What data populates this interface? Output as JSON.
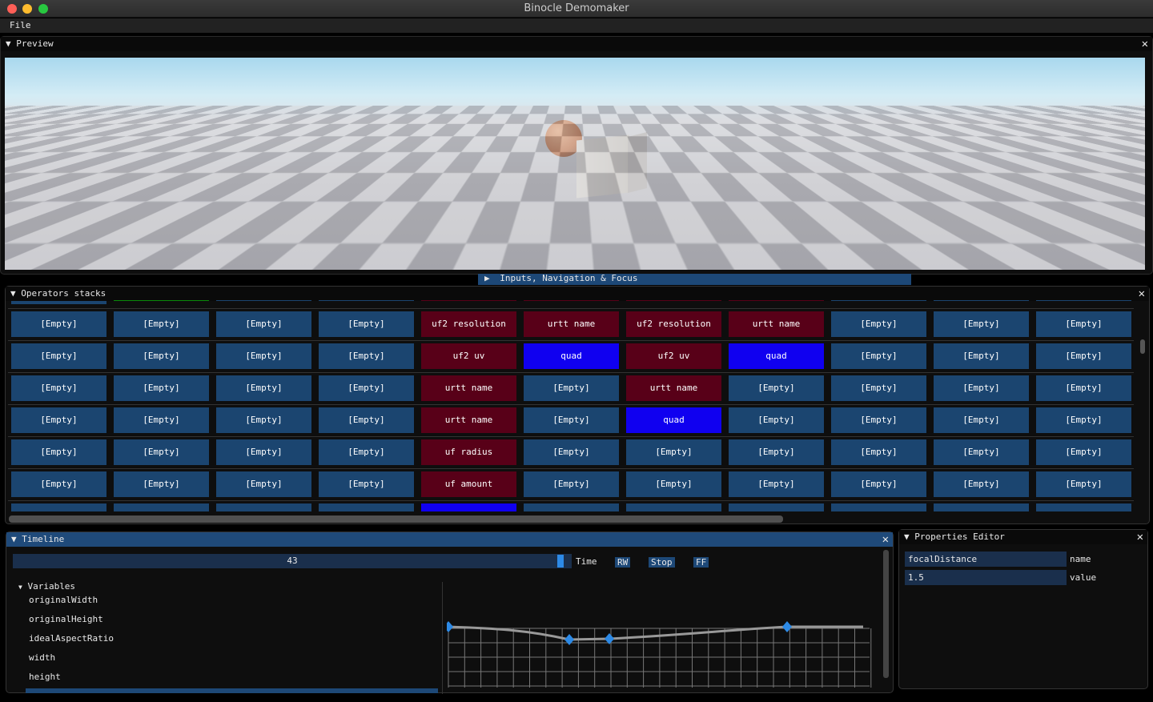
{
  "window": {
    "title": "Binocle Demomaker"
  },
  "menu": {
    "file": "File"
  },
  "preview": {
    "title": "Preview"
  },
  "inputs_panel": {
    "title": "Inputs, Navigation & Focus"
  },
  "operators": {
    "title": "Operators stacks",
    "header_colors": [
      "#1b4570",
      "#0a8a0a",
      "#1b4570",
      "#1b4570",
      "#580018",
      "#580018",
      "#580018",
      "#580018",
      "#1b4570",
      "#1b4570",
      "#1b4570"
    ],
    "colors": {
      "empty": "#1b4570",
      "uniform": "#580018",
      "quad": "#1000f0"
    },
    "rows": [
      [
        [
          "[Empty]",
          "e"
        ],
        [
          "[Empty]",
          "e"
        ],
        [
          "[Empty]",
          "e"
        ],
        [
          "[Empty]",
          "e"
        ],
        [
          "uf2 resolution",
          "r"
        ],
        [
          "urtt name",
          "r"
        ],
        [
          "uf2 resolution",
          "r"
        ],
        [
          "urtt name",
          "r"
        ],
        [
          "[Empty]",
          "e"
        ],
        [
          "[Empty]",
          "e"
        ],
        [
          "[Empty]",
          "e"
        ]
      ],
      [
        [
          "[Empty]",
          "e"
        ],
        [
          "[Empty]",
          "e"
        ],
        [
          "[Empty]",
          "e"
        ],
        [
          "[Empty]",
          "e"
        ],
        [
          "uf2 uv",
          "r"
        ],
        [
          "quad",
          "b"
        ],
        [
          "uf2 uv",
          "r"
        ],
        [
          "quad",
          "b"
        ],
        [
          "[Empty]",
          "e"
        ],
        [
          "[Empty]",
          "e"
        ],
        [
          "[Empty]",
          "e"
        ]
      ],
      [
        [
          "[Empty]",
          "e"
        ],
        [
          "[Empty]",
          "e"
        ],
        [
          "[Empty]",
          "e"
        ],
        [
          "[Empty]",
          "e"
        ],
        [
          "urtt name",
          "r"
        ],
        [
          "[Empty]",
          "e"
        ],
        [
          "urtt name",
          "r"
        ],
        [
          "[Empty]",
          "e"
        ],
        [
          "[Empty]",
          "e"
        ],
        [
          "[Empty]",
          "e"
        ],
        [
          "[Empty]",
          "e"
        ]
      ],
      [
        [
          "[Empty]",
          "e"
        ],
        [
          "[Empty]",
          "e"
        ],
        [
          "[Empty]",
          "e"
        ],
        [
          "[Empty]",
          "e"
        ],
        [
          "urtt name",
          "r"
        ],
        [
          "[Empty]",
          "e"
        ],
        [
          "quad",
          "b"
        ],
        [
          "[Empty]",
          "e"
        ],
        [
          "[Empty]",
          "e"
        ],
        [
          "[Empty]",
          "e"
        ],
        [
          "[Empty]",
          "e"
        ]
      ],
      [
        [
          "[Empty]",
          "e"
        ],
        [
          "[Empty]",
          "e"
        ],
        [
          "[Empty]",
          "e"
        ],
        [
          "[Empty]",
          "e"
        ],
        [
          "uf radius",
          "r"
        ],
        [
          "[Empty]",
          "e"
        ],
        [
          "[Empty]",
          "e"
        ],
        [
          "[Empty]",
          "e"
        ],
        [
          "[Empty]",
          "e"
        ],
        [
          "[Empty]",
          "e"
        ],
        [
          "[Empty]",
          "e"
        ]
      ],
      [
        [
          "[Empty]",
          "e"
        ],
        [
          "[Empty]",
          "e"
        ],
        [
          "[Empty]",
          "e"
        ],
        [
          "[Empty]",
          "e"
        ],
        [
          "uf amount",
          "r"
        ],
        [
          "[Empty]",
          "e"
        ],
        [
          "[Empty]",
          "e"
        ],
        [
          "[Empty]",
          "e"
        ],
        [
          "[Empty]",
          "e"
        ],
        [
          "[Empty]",
          "e"
        ],
        [
          "[Empty]",
          "e"
        ]
      ],
      [
        [
          "",
          "e"
        ],
        [
          "",
          "e"
        ],
        [
          "",
          "e"
        ],
        [
          "",
          "e"
        ],
        [
          "",
          "b"
        ],
        [
          "",
          "e"
        ],
        [
          "",
          "e"
        ],
        [
          "",
          "e"
        ],
        [
          "",
          "e"
        ],
        [
          "",
          "e"
        ],
        [
          "",
          "e"
        ]
      ]
    ]
  },
  "timeline": {
    "title": "Timeline",
    "time_value": "43",
    "time_fraction": 0.985,
    "time_label": "Time",
    "rw": "RW",
    "stop": "Stop",
    "ff": "FF",
    "variables_label": "Variables",
    "variables": [
      "originalWidth",
      "originalHeight",
      "idealAspectRatio",
      "width",
      "height"
    ]
  },
  "properties": {
    "title": "Properties Editor",
    "name_value": "focalDistance",
    "name_label": "name",
    "value_value": "1.5",
    "value_label": "value"
  }
}
